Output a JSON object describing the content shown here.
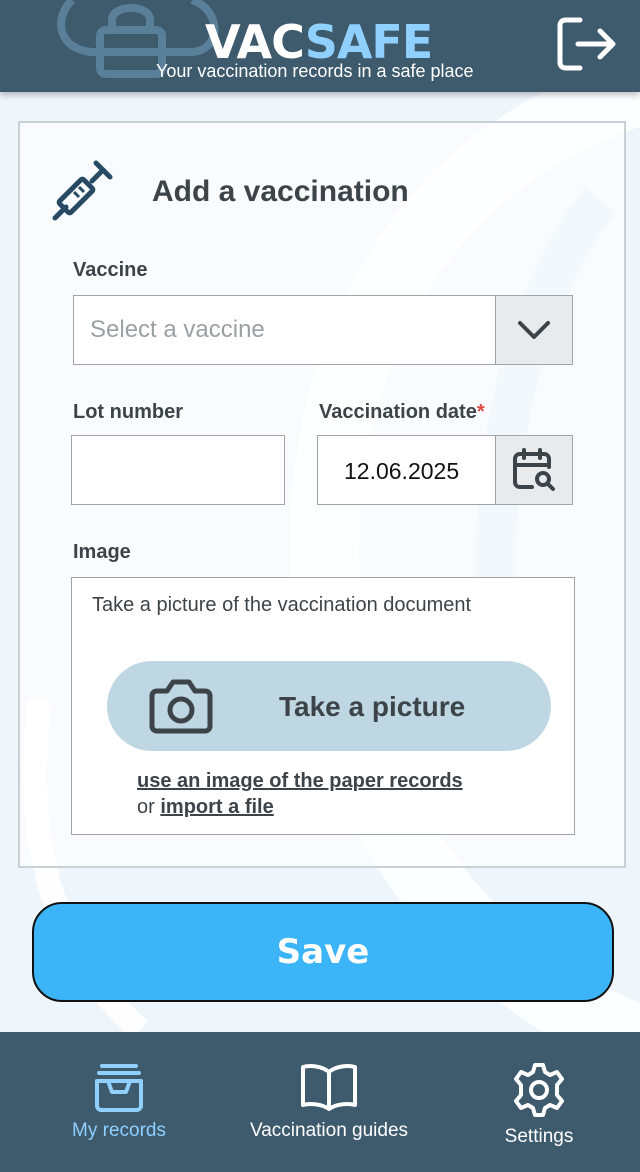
{
  "header": {
    "brand_part1": "VAC",
    "brand_part2": "SAFE",
    "tagline": "Your vaccination records in a safe place",
    "logout_icon": "logout-icon"
  },
  "form": {
    "title": "Add a vaccination",
    "title_icon": "syringe-icon",
    "vaccine": {
      "label": "Vaccine",
      "placeholder": "Select a vaccine",
      "icon": "chevron-down-icon"
    },
    "lot_number": {
      "label": "Lot number",
      "value": ""
    },
    "vaccination_date": {
      "label": "Vaccination date",
      "required_marker": "*",
      "value": "12.06.2025",
      "icon": "calendar-search-icon"
    },
    "image": {
      "label": "Image",
      "hint": "Take a picture of the vaccination document",
      "take_picture_label": "Take a picture",
      "take_picture_icon": "camera-icon",
      "paper_records_link": "use an image of the paper records",
      "or_text": "or",
      "import_link": "import a file"
    }
  },
  "save_label": "Save",
  "nav": {
    "items": [
      {
        "label": "My records",
        "icon": "records-tray-icon",
        "active": true
      },
      {
        "label": "Vaccination guides",
        "icon": "book-icon",
        "active": false
      },
      {
        "label": "Settings",
        "icon": "gear-icon",
        "active": false
      }
    ]
  },
  "colors": {
    "header_bg": "#3e5a6d",
    "accent": "#3bb4f8",
    "brand_light": "#8fd0ff",
    "active_nav": "#8fd0ff",
    "required": "#e0453d",
    "take_picture_bg": "#bfd6e3"
  }
}
